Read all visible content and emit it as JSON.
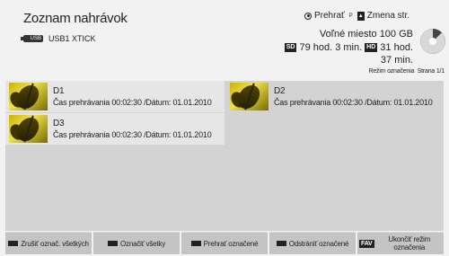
{
  "header": {
    "title": "Zoznam nahrávok",
    "usb_icon_text": "USB",
    "device": "USB1 XTICK",
    "legend_play": "Prehrať",
    "legend_p_key": "P",
    "legend_page": "Zmena str.",
    "free_space": "Voľné miesto 100 GB",
    "sd_badge": "SD",
    "sd_time": "79 hod. 3 min.",
    "hd_badge": "HD",
    "hd_time": "31 hod.",
    "hd_time_min": "37 min.",
    "mode": "Režim označenia",
    "page": "Strana 1/1"
  },
  "recordings": [
    {
      "name": "D1",
      "meta": "Čas prehrávania 00:02:30 /Dátum: 01.01.2010",
      "selected": true
    },
    {
      "name": "D2",
      "meta": "Čas prehrávania 00:02:30 /Dátum: 01.01.2010",
      "selected": false
    },
    {
      "name": "D3",
      "meta": "Čas prehrávania 00:02:30 /Dátum: 01.01.2010",
      "selected": true
    }
  ],
  "footer": {
    "unmark_all": "Zrušiť označ. všetkých",
    "mark_all": "Označiť všetky",
    "play_marked": "Prehrať označené",
    "delete_marked": "Odstrániť označené",
    "fav_key": "FAV",
    "exit_mode": "Ukončiť režim označenia"
  },
  "colors": {
    "background": "#f2f2f2",
    "list_background": "#d3d3d3",
    "selected_item": "#e6e6e6",
    "footer_button": "#c4c4c4"
  }
}
